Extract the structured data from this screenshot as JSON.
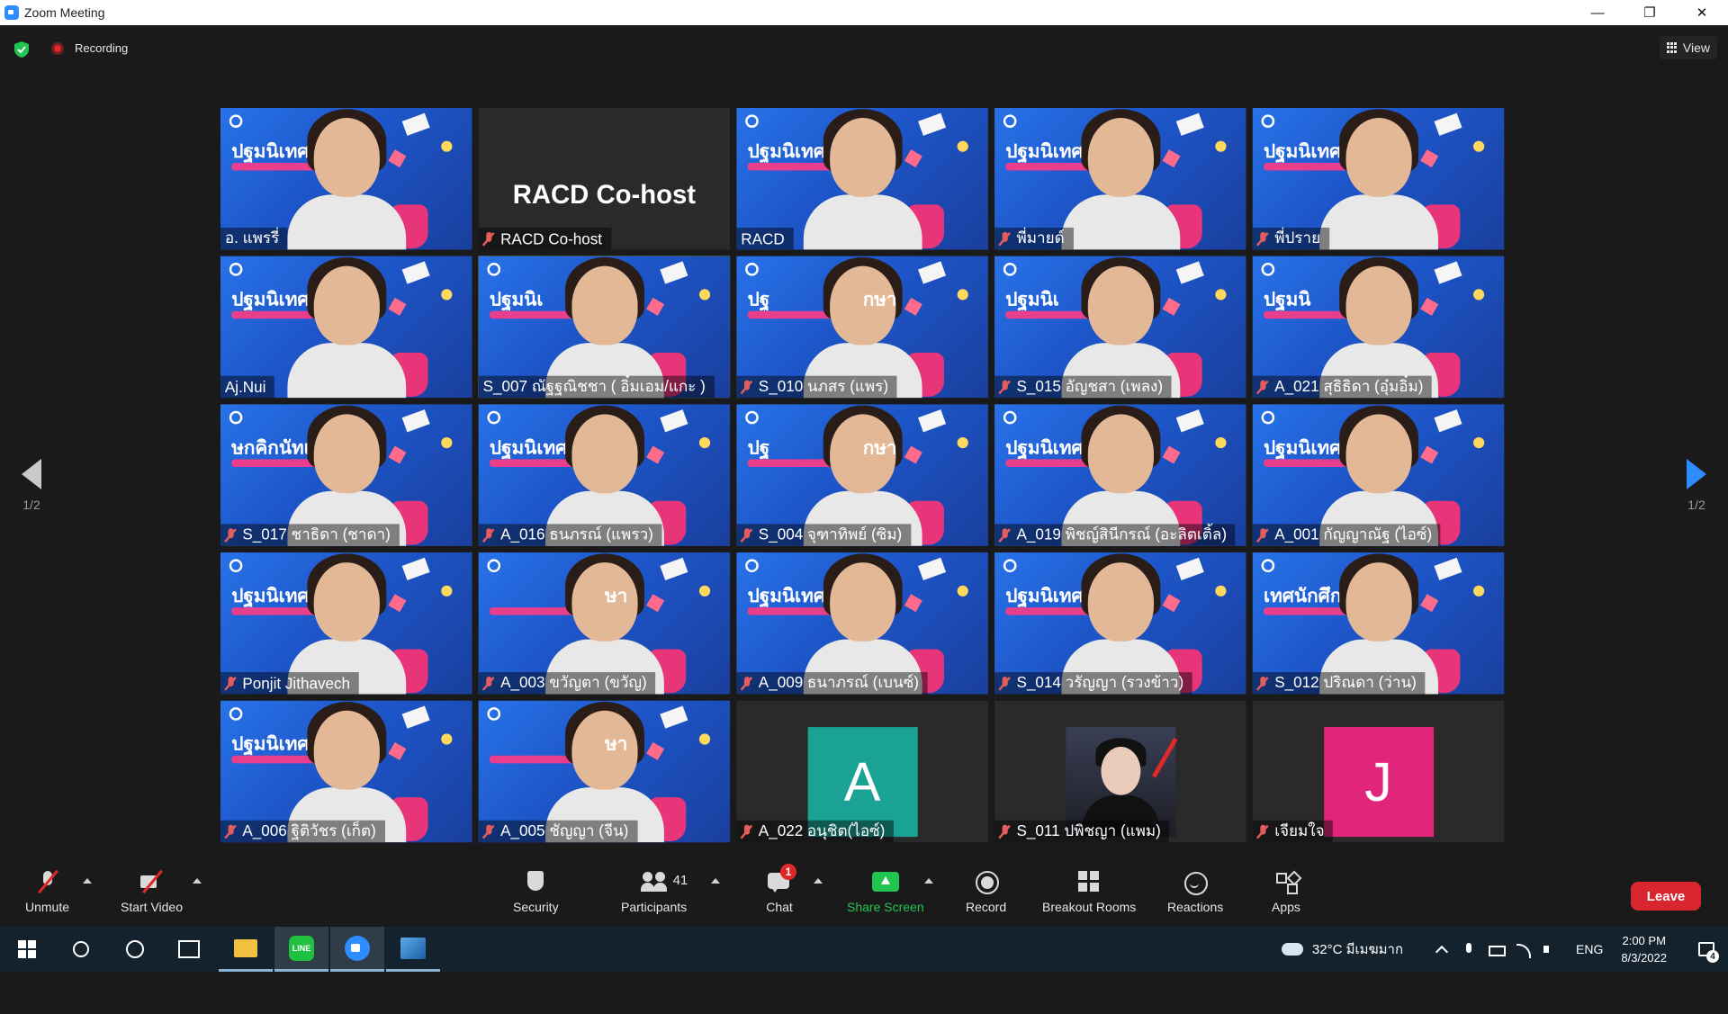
{
  "window": {
    "title": "Zoom Meeting",
    "controls": [
      "—",
      "❐",
      "✕"
    ]
  },
  "topbar": {
    "recording_label": "Recording",
    "view_label": "View"
  },
  "pager": {
    "left_page": "1/2",
    "right_page": "1/2"
  },
  "participants": [
    {
      "name": "อ. แพรรี่",
      "muted": false,
      "type": "video",
      "banner": "ปฐมนิเทศ"
    },
    {
      "name": "RACD Co-host",
      "muted": true,
      "type": "name",
      "big_name": "RACD Co-host"
    },
    {
      "name": "RACD",
      "muted": false,
      "type": "video",
      "banner": "ปฐมนิเทศนักศึกษา"
    },
    {
      "name": "พี่มายด์",
      "muted": true,
      "type": "video",
      "banner": "ปฐมนิเทศนักศึกษา"
    },
    {
      "name": "พี่ปราย",
      "muted": true,
      "type": "video",
      "banner": "ปฐมนิเทศนักศึกษา"
    },
    {
      "name": "Aj.Nui",
      "muted": false,
      "type": "video",
      "banner": "ปฐมนิเทศนักศึกษา"
    },
    {
      "name": "S_007 ณัฐฐณิชชา ( อิ๋มเอม/แกะ )",
      "muted": false,
      "type": "video",
      "banner": "ปฐมนิเ",
      "active": true
    },
    {
      "name": "S_010 นภสร (แพร)",
      "muted": true,
      "type": "video",
      "banner": "ปฐ",
      "banner2": "กษา"
    },
    {
      "name": "S_015 อัญชสา (เพลง)",
      "muted": true,
      "type": "video",
      "banner": "ปฐมนิเ"
    },
    {
      "name": "A_021 สุธิธิดา (อุ๋มอิ๋ม)",
      "muted": true,
      "type": "video",
      "banner": "ปฐมนิ"
    },
    {
      "name": "S_017 ชาธิดา (ชาดา)",
      "muted": true,
      "type": "video",
      "banner": "ษกคิกนัทเคนิมฐป"
    },
    {
      "name": "A_016 ธนภรณ์ (แพรว)",
      "muted": true,
      "type": "video",
      "banner": "ปฐมนิเทศนักศึกษา"
    },
    {
      "name": "S_004 จุฑาทิพย์ (ซิม)",
      "muted": true,
      "type": "video",
      "banner": "ปฐ",
      "banner2": "กษา"
    },
    {
      "name": "A_019 พิชญ์สินีกรณ์ (อะลิตเติ้ล)",
      "muted": true,
      "type": "video",
      "banner": "ปฐมนิเทศนักศึกษา"
    },
    {
      "name": "A_001 กัญญาณัฐ (ไอซ์)",
      "muted": true,
      "type": "video",
      "banner": "ปฐมนิเทศนัก"
    },
    {
      "name": "Ponjit Jithavech",
      "muted": true,
      "type": "video",
      "banner": "ปฐมนิเทศนักศึ"
    },
    {
      "name": "A_003 ขวัญตา (ขวัญ)",
      "muted": true,
      "type": "video",
      "banner": "",
      "banner2": "ษา"
    },
    {
      "name": "A_009 ธนาภรณ์ (เบนซ์)",
      "muted": true,
      "type": "video",
      "banner": "ปฐมนิเทศนักศึกษา"
    },
    {
      "name": "S_014 วรัญญา (รวงข้าว)",
      "muted": true,
      "type": "video",
      "banner": "ปฐมนิเทศนักศึ"
    },
    {
      "name": "S_012 ปริณดา (ว่าน)",
      "muted": true,
      "type": "video",
      "banner": "เทศนักศึกษา"
    },
    {
      "name": "A_006 ฐิติวัชร (เก็ต)",
      "muted": true,
      "type": "video",
      "banner": "ปฐมนิเทศนักศึกษา"
    },
    {
      "name": "A_005 ชัญญา (จีน)",
      "muted": true,
      "type": "video",
      "banner": "",
      "banner2": "ษา"
    },
    {
      "name": "A_022 อนุชิต(ไอซ์)",
      "muted": true,
      "type": "avatar",
      "letter": "A",
      "color": "#1aa394"
    },
    {
      "name": "S_011 ปพิชญา (แพม)",
      "muted": true,
      "type": "photo"
    },
    {
      "name": "เจียมใจ",
      "muted": true,
      "type": "avatar",
      "letter": "J",
      "color": "#e0257a"
    }
  ],
  "toolbar": {
    "unmute": "Unmute",
    "start_video": "Start Video",
    "security": "Security",
    "participants": "Participants",
    "participants_count": "41",
    "chat": "Chat",
    "chat_badge": "1",
    "share_screen": "Share Screen",
    "record": "Record",
    "breakout_rooms": "Breakout Rooms",
    "reactions": "Reactions",
    "apps": "Apps",
    "leave": "Leave"
  },
  "taskbar": {
    "line_label": "LINE",
    "weather": "32°C มีเมฆมาก",
    "language": "ENG",
    "time": "2:00 PM",
    "date": "8/3/2022",
    "notifications": "4"
  },
  "colors": {
    "zoom_blue": "#2d8cff",
    "share_green": "#23c552",
    "leave_red": "#d9252d",
    "active_speaker": "#c6e36a"
  }
}
